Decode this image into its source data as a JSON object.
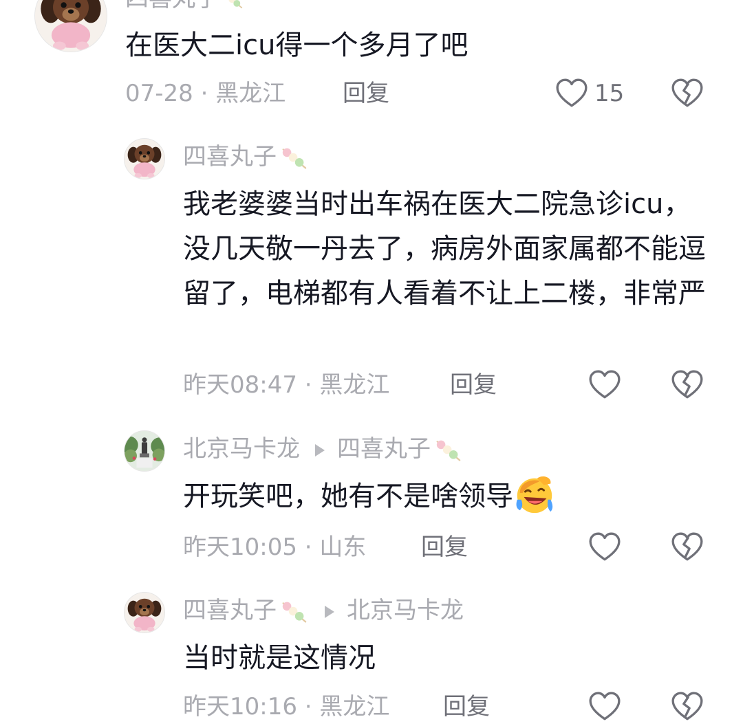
{
  "comments": [
    {
      "username": "四喜丸子",
      "text": "在医大二icu得一个多月了吧",
      "date": "07-28",
      "location": "黑龙江",
      "reply_label": "回复",
      "like_count": "15",
      "avatar": "puppy-avatar"
    },
    {
      "username": "四喜丸子",
      "text": "我老婆婆当时出车祸在医大二院急诊icu，没几天敬一丹去了，病房外面家属都不能逗留了，电梯都有人看着不让上二楼，非常严",
      "date": "昨天08:47",
      "location": "黑龙江",
      "reply_label": "回复",
      "avatar": "puppy-avatar"
    },
    {
      "username": "北京马卡龙",
      "reply_to": "四喜丸子",
      "text": "开玩笑吧，她有不是啥领导",
      "emoji": "laughing-crying-emoji",
      "date": "昨天10:05",
      "location": "山东",
      "reply_label": "回复",
      "avatar": "statue-avatar"
    },
    {
      "username": "四喜丸子",
      "reply_to": "北京马卡龙",
      "text": "当时就是这情况",
      "date": "昨天10:16",
      "location": "黑龙江",
      "reply_label": "回复",
      "avatar": "puppy-avatar"
    }
  ],
  "separator": " · ",
  "colors": {
    "text": "#161823",
    "meta": "#a9aab0",
    "action": "#6f7078"
  }
}
